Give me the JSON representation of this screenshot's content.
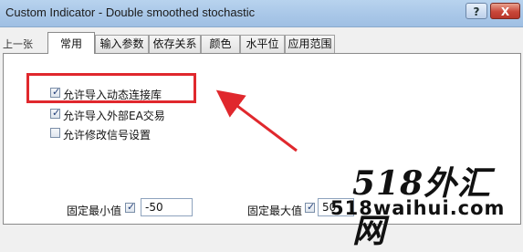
{
  "window": {
    "title": "Custom Indicator - Double smoothed stochastic",
    "help_label": "?",
    "close_label": "X"
  },
  "prev_tab_label": "上一张",
  "tabs": [
    {
      "label": "常用"
    },
    {
      "label": "输入参数"
    },
    {
      "label": "依存关系"
    },
    {
      "label": "颜色"
    },
    {
      "label": "水平位"
    },
    {
      "label": "应用范围"
    }
  ],
  "options": [
    {
      "label": "允许导入动态连接库",
      "checked": true
    },
    {
      "label": "允许导入外部EA交易",
      "checked": true
    },
    {
      "label": "允许修改信号设置",
      "checked": false
    }
  ],
  "fixed_min": {
    "label": "固定最小值",
    "checked": true,
    "value": "-50"
  },
  "fixed_max": {
    "label": "固定最大值",
    "checked": true,
    "value": "50"
  },
  "watermark": {
    "big": "518外汇网",
    "small": "518waihui.com"
  },
  "colors": {
    "annotation": "#e0282d"
  }
}
